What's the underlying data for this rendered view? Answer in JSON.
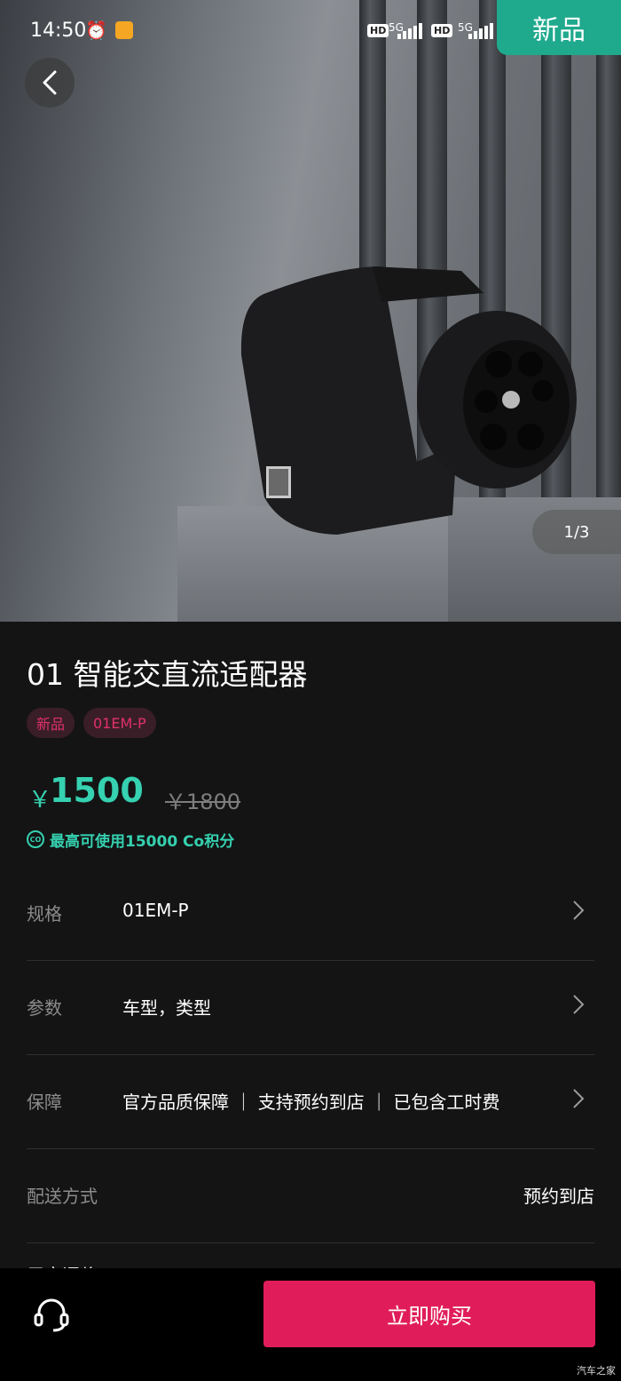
{
  "status_bar": {
    "time": "14:50",
    "hd1": "HD",
    "sig1": "5G",
    "hd2": "HD",
    "sig2": "5G"
  },
  "hero": {
    "badge": "新品",
    "pager": "1/3"
  },
  "product": {
    "title": "01 智能交直流适配器",
    "tags": [
      "新品",
      "01EM-P"
    ],
    "price_symbol": "￥",
    "price": "1500",
    "original_price": "￥1800",
    "points_icon": "CO",
    "points_text": "最高可使用15000 Co积分"
  },
  "rows": {
    "spec": {
      "label": "规格",
      "value": "01EM-P"
    },
    "params": {
      "label": "参数",
      "value": "车型，类型"
    },
    "guarantee": {
      "label": "保障",
      "value": "官方品质保障 ｜ 支持预约到店 ｜ 已包含工时费"
    },
    "delivery": {
      "label": "配送方式",
      "value": "预约到店"
    }
  },
  "partial_row": "用户评价",
  "bottom": {
    "buy_label": "立即购买"
  },
  "watermark": "汽车之家",
  "colors": {
    "accent": "#35d1b0",
    "buy": "#e01d5a",
    "tag_text": "#e0316b",
    "badge": "#1fa98d"
  },
  "icons": [
    "alarm-icon",
    "note-icon",
    "back-icon",
    "chevron-right-icon",
    "headset-icon"
  ]
}
